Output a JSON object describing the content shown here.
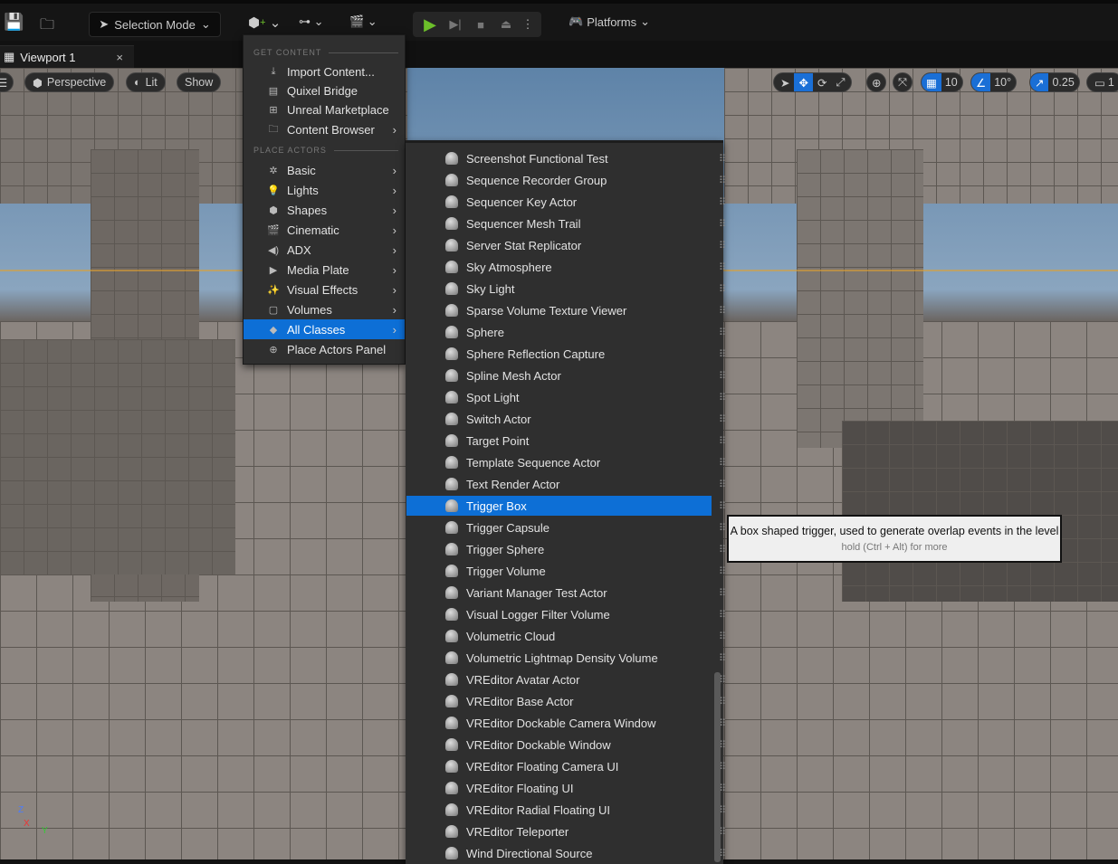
{
  "toolbar": {
    "selection_mode": "Selection Mode",
    "platforms": "Platforms"
  },
  "tab": {
    "label": "Viewport 1",
    "close": "×"
  },
  "viewport": {
    "perspective": "Perspective",
    "lit": "Lit",
    "show": "Show",
    "grid_snap": "10",
    "rotation_snap": "10°",
    "scale_snap": "0.25",
    "camera_speed": "1"
  },
  "menu": {
    "get_content_header": "GET CONTENT",
    "get_content": [
      {
        "label": "Import Content..."
      },
      {
        "label": "Quixel Bridge"
      },
      {
        "label": "Unreal Marketplace"
      },
      {
        "label": "Content Browser"
      }
    ],
    "place_actors_header": "PLACE ACTORS",
    "place_actors": [
      {
        "label": "Basic"
      },
      {
        "label": "Lights"
      },
      {
        "label": "Shapes"
      },
      {
        "label": "Cinematic"
      },
      {
        "label": "ADX"
      },
      {
        "label": "Media Plate"
      },
      {
        "label": "Visual Effects"
      },
      {
        "label": "Volumes"
      },
      {
        "label": "All Classes"
      },
      {
        "label": "Place Actors Panel"
      }
    ]
  },
  "all_classes": [
    "Screenshot Functional Test",
    "Sequence Recorder Group",
    "Sequencer Key Actor",
    "Sequencer Mesh Trail",
    "Server Stat Replicator",
    "Sky Atmosphere",
    "Sky Light",
    "Sparse Volume Texture Viewer",
    "Sphere",
    "Sphere Reflection Capture",
    "Spline Mesh Actor",
    "Spot Light",
    "Switch Actor",
    "Target Point",
    "Template Sequence Actor",
    "Text Render Actor",
    "Trigger Box",
    "Trigger Capsule",
    "Trigger Sphere",
    "Trigger Volume",
    "Variant Manager Test Actor",
    "Visual Logger Filter Volume",
    "Volumetric Cloud",
    "Volumetric Lightmap Density Volume",
    "VREditor Avatar Actor",
    "VREditor Base Actor",
    "VREditor Dockable Camera Window",
    "VREditor Dockable Window",
    "VREditor Floating Camera UI",
    "VREditor Floating UI",
    "VREditor Radial Floating UI",
    "VREditor Teleporter",
    "Wind Directional Source"
  ],
  "selected_class": "Trigger Box",
  "tooltip": {
    "text": "A box shaped trigger, used to generate overlap events in the level",
    "hint": "hold (Ctrl + Alt) for more"
  },
  "axis": {
    "z": "Z",
    "x": "X",
    "y": "Y"
  },
  "colors": {
    "accent": "#0d6fd6",
    "play": "#6cbf2a"
  }
}
